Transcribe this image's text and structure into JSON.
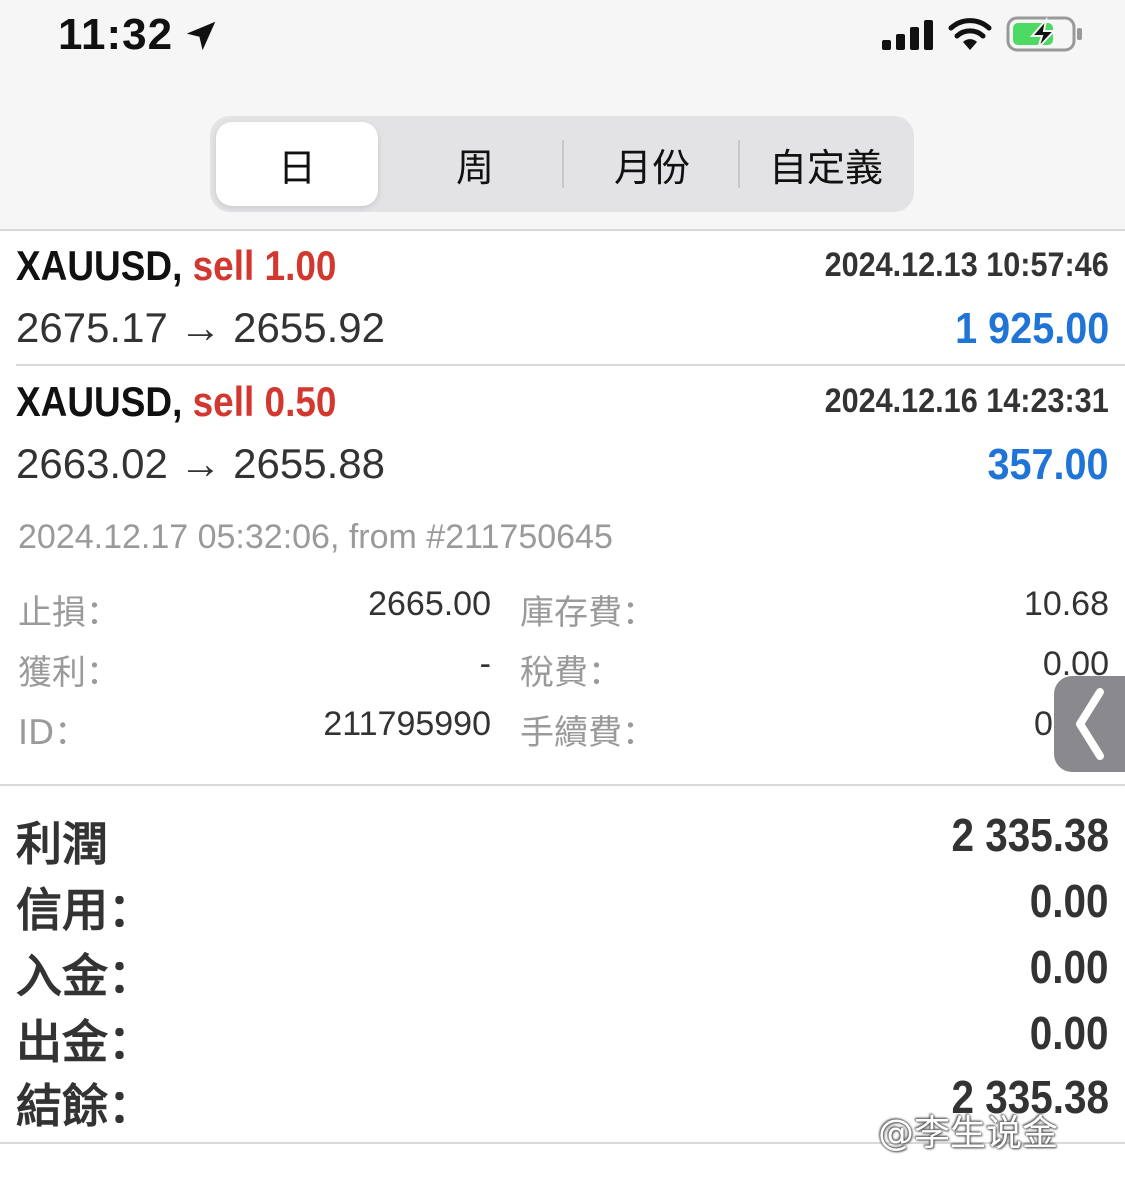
{
  "status_bar": {
    "time": "11:32",
    "icons": [
      "location-arrow-icon",
      "cellular-signal-icon",
      "wifi-icon",
      "battery-charging-icon"
    ]
  },
  "tabs": {
    "selected": "日",
    "items": [
      {
        "label": "日"
      },
      {
        "label": "周"
      },
      {
        "label": "月份"
      },
      {
        "label": "自定義"
      }
    ]
  },
  "trades": [
    {
      "symbol": "XAUUSD,",
      "side": "sell 1.00",
      "datetime": "2024.12.13 10:57:46",
      "prices": "2675.17 → 2655.92",
      "profit": "1 925.00"
    },
    {
      "symbol": "XAUUSD,",
      "side": "sell 0.50",
      "datetime": "2024.12.16 14:23:31",
      "prices": "2663.02 → 2655.88",
      "profit": "357.00",
      "details": {
        "line": "2024.12.17 05:32:06, from #211750645",
        "stop_loss_label": "止損：",
        "stop_loss_value": "2665.00",
        "take_profit_label": "獲利：",
        "take_profit_value": "-",
        "id_label": "ID：",
        "id_value": "211795990",
        "swap_label": "庫存費：",
        "swap_value": "10.68",
        "tax_label": "稅費：",
        "tax_value": "0.00",
        "commission_label": "手續費：",
        "commission_value": "0"
      }
    }
  ],
  "summary": {
    "profit_label": "利潤",
    "profit_value": "2 335.38",
    "credit_label": "信用：",
    "credit_value": "0.00",
    "deposit_label": "入金：",
    "deposit_value": "0.00",
    "withdrawal_label": "出金：",
    "withdrawal_value": "0.00",
    "balance_label": "結餘：",
    "balance_value": "2 335.38"
  },
  "watermark": "@李生说金",
  "colors": {
    "sell": "#d2382f",
    "profit_positive": "#1f74d6",
    "segmented_bg": "#e3e3e6"
  }
}
